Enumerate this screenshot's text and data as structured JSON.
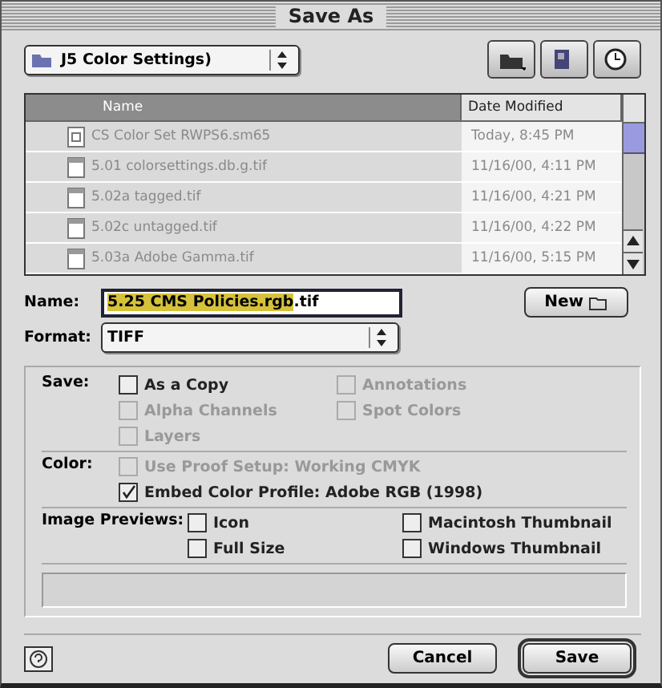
{
  "window": {
    "title": "Save As"
  },
  "folder": {
    "label": "J5 Color Settings)"
  },
  "toolbar": [
    {
      "kind": "folder"
    },
    {
      "kind": "disk"
    },
    {
      "kind": "clock"
    }
  ],
  "files": {
    "columns": [
      {
        "label": "Name",
        "selected": true
      },
      {
        "label": "Date Modified",
        "selected": false
      }
    ],
    "rows": [
      {
        "kind": "doc",
        "name": "CS Color Set RWPS6.sm65",
        "date": "Today, 8:45 PM"
      },
      {
        "kind": "image",
        "name": "5.01 colorsettings.db.g.tif",
        "date": "11/16/00, 4:11 PM"
      },
      {
        "kind": "image",
        "name": "5.02a tagged.tif",
        "date": "11/16/00, 4:21 PM"
      },
      {
        "kind": "image",
        "name": "5.02c untagged.tif",
        "date": "11/16/00, 4:22 PM"
      },
      {
        "kind": "image",
        "name": "5.03a Adobe Gamma.tif",
        "date": "11/16/00, 5:15 PM"
      }
    ]
  },
  "name_field": {
    "label": "Name:",
    "parts": [
      {
        "text": "5.25 CMS Policies.rgb",
        "selected": true
      },
      {
        "text": ".tif",
        "selected": false
      }
    ]
  },
  "new_button": {
    "label": "New"
  },
  "format": {
    "label": "Format:",
    "value": "TIFF"
  },
  "save_options": {
    "label": "Save:",
    "items": [
      {
        "label": "As a Copy",
        "checked": false,
        "disabled": false
      },
      {
        "label": "Annotations",
        "checked": false,
        "disabled": true
      },
      {
        "label": "Alpha Channels",
        "checked": false,
        "disabled": true
      },
      {
        "label": "Spot Colors",
        "checked": false,
        "disabled": true
      },
      {
        "label": "Layers",
        "checked": false,
        "disabled": true
      }
    ]
  },
  "color_options": {
    "label": "Color:",
    "items": [
      {
        "label": "Use Proof Setup: Working CMYK",
        "checked": false,
        "disabled": true
      },
      {
        "label": "Embed Color Profile: Adobe RGB (1998)",
        "checked": true,
        "disabled": false
      }
    ]
  },
  "previews": {
    "label": "Image Previews:",
    "items": [
      {
        "label": "Icon",
        "checked": false,
        "disabled": false
      },
      {
        "label": "Macintosh Thumbnail",
        "checked": false,
        "disabled": false
      },
      {
        "label": "Full Size",
        "checked": false,
        "disabled": false
      },
      {
        "label": "Windows Thumbnail",
        "checked": false,
        "disabled": false
      }
    ]
  },
  "buttons": [
    {
      "label": "Cancel",
      "default": false
    },
    {
      "label": "Save",
      "default": true
    }
  ]
}
